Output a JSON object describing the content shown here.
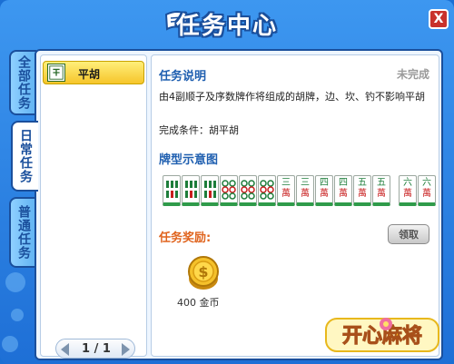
{
  "window": {
    "title": "任务中心",
    "close_label": "X"
  },
  "tabs": [
    {
      "label": "全部任务",
      "active": false
    },
    {
      "label": "日常任务",
      "active": true
    },
    {
      "label": "普通任务",
      "active": false
    }
  ],
  "task_list": {
    "items": [
      {
        "label": "平胡",
        "icon": "mahjong-tile-icon"
      }
    ]
  },
  "pager": {
    "text": "1 / 1"
  },
  "detail": {
    "desc_title": "任务说明",
    "status": "未完成",
    "description": "由4副顺子及序数牌作将组成的胡牌，边、坎、钓不影响平胡",
    "condition": "完成条件：胡平胡",
    "pattern_title": "牌型示意图",
    "tiles": [
      {
        "top": "",
        "bottom": "",
        "suit": "bamboo"
      },
      {
        "top": "",
        "bottom": "",
        "suit": "bamboo"
      },
      {
        "top": "",
        "bottom": "",
        "suit": "bamboo"
      },
      {
        "top": "",
        "bottom": "",
        "suit": "dots"
      },
      {
        "top": "",
        "bottom": "",
        "suit": "dots"
      },
      {
        "top": "",
        "bottom": "",
        "suit": "dots"
      },
      {
        "top": "三",
        "bottom": "萬",
        "suit": "character"
      },
      {
        "top": "三",
        "bottom": "萬",
        "suit": "character"
      },
      {
        "top": "四",
        "bottom": "萬",
        "suit": "character"
      },
      {
        "top": "四",
        "bottom": "萬",
        "suit": "character"
      },
      {
        "top": "五",
        "bottom": "萬",
        "suit": "character"
      },
      {
        "top": "五",
        "bottom": "萬",
        "suit": "character"
      },
      {
        "top": "六",
        "bottom": "萬",
        "suit": "character"
      },
      {
        "top": "六",
        "bottom": "萬",
        "suit": "character"
      }
    ],
    "reward_title": "任务奖励:",
    "claim_label": "领取",
    "reward_amount": "400 金币",
    "reward_icon": "gold-coin-icon"
  },
  "logo": {
    "text": "开心麻将"
  },
  "colors": {
    "window_blue": "#1e6fd6",
    "title_outline": "#1a4f9c",
    "reward_orange": "#e0641e",
    "section_blue": "#1f5fb0",
    "tile_green": "#2f9b4a"
  }
}
